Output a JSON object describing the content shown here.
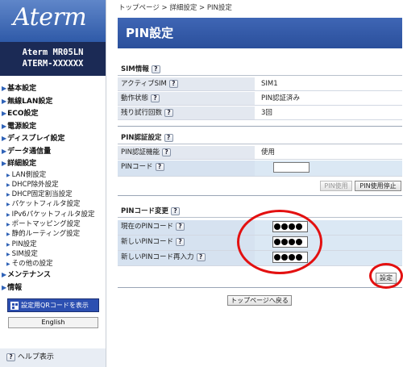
{
  "sidebar": {
    "logo": "Aterm",
    "model_line1": "Aterm  MR05LN",
    "model_line2": "ATERM-XXXXXX",
    "menu": [
      {
        "label": "基本設定",
        "level": "top"
      },
      {
        "label": "無線LAN設定",
        "level": "top"
      },
      {
        "label": "ECO設定",
        "level": "top"
      },
      {
        "label": "電源設定",
        "level": "top"
      },
      {
        "label": "ディスプレイ設定",
        "level": "top"
      },
      {
        "label": "データ通信量",
        "level": "top"
      },
      {
        "label": "詳細設定",
        "level": "top"
      },
      {
        "label": "LAN側設定",
        "level": "sub"
      },
      {
        "label": "DHCP除外設定",
        "level": "sub"
      },
      {
        "label": "DHCP固定割当設定",
        "level": "sub"
      },
      {
        "label": "パケットフィルタ設定",
        "level": "sub"
      },
      {
        "label": "IPv6パケットフィルタ設定",
        "level": "sub"
      },
      {
        "label": "ポートマッピング設定",
        "level": "sub"
      },
      {
        "label": "静的ルーティング設定",
        "level": "sub"
      },
      {
        "label": "PIN設定",
        "level": "sub"
      },
      {
        "label": "SIM設定",
        "level": "sub"
      },
      {
        "label": "その他の設定",
        "level": "sub"
      },
      {
        "label": "メンテナンス",
        "level": "top"
      },
      {
        "label": "情報",
        "level": "top"
      }
    ],
    "qr_button": "設定用QRコードを表示",
    "lang_button": "English",
    "help": "ヘルプ表示",
    "help_icon": "?"
  },
  "breadcrumb": "トップページ > 詳細設定 > PIN設定",
  "page_title": "PIN設定",
  "sim_info": {
    "heading": "SIM情報",
    "rows": [
      {
        "label": "アクティブSIM",
        "value": "SIM1"
      },
      {
        "label": "動作状態",
        "value": "PIN認証済み"
      },
      {
        "label": "残り試行回数",
        "value": "3回"
      }
    ]
  },
  "pin_auth": {
    "heading": "PIN認証設定",
    "function_label": "PIN認証機能",
    "function_value": "使用",
    "code_label": "PINコード",
    "code_value": "",
    "use_button": "PIN使用",
    "stop_button": "PIN使用停止"
  },
  "pin_change": {
    "heading": "PINコード変更",
    "current_label": "現在のPINコード",
    "new_label": "新しいPINコード",
    "new_confirm_label": "新しいPINコード再入力",
    "current_value": "●●●●",
    "new_value": "●●●●",
    "confirm_value": "●●●●"
  },
  "set_button": "設定",
  "back_button": "トップページへ戻る",
  "colors": {
    "title_bar": "#3f66b5",
    "model_box": "#1b2a55",
    "highlight": "#e31010"
  }
}
